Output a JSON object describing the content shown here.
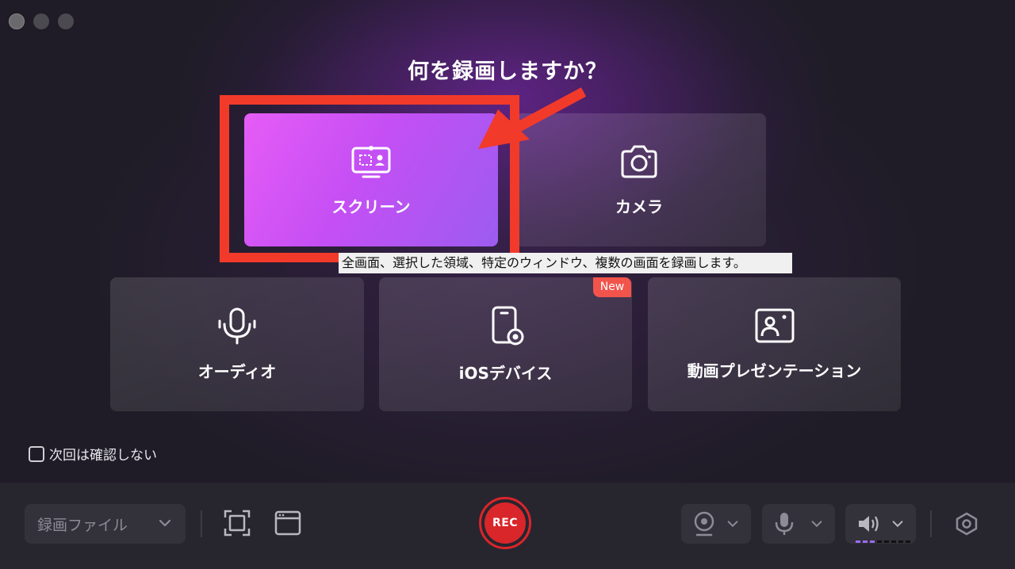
{
  "window": {
    "title": "何を録画しますか？"
  },
  "cards": [
    {
      "id": "screen",
      "label": "スクリーン",
      "icon": "screen-record-icon",
      "selected": true
    },
    {
      "id": "camera",
      "label": "カメラ",
      "icon": "camera-icon",
      "selected": false
    },
    {
      "id": "audio",
      "label": "オーディオ",
      "icon": "microphone-icon",
      "selected": false
    },
    {
      "id": "ios",
      "label": "iOSデバイス",
      "icon": "ios-device-icon",
      "selected": false,
      "badge": "New"
    },
    {
      "id": "presentation",
      "label": "動画プレゼンテーション",
      "icon": "presentation-icon",
      "selected": false
    }
  ],
  "tooltip": "全画面、選択した領域、特定のウィンドウ、複数の画面を録画します。",
  "options": {
    "dont_ask_label": "次回は確認しない",
    "dont_ask_checked": false
  },
  "toolbar": {
    "file_dropdown_value": "録画ファイル",
    "rec_label": "REC",
    "audio_level_active_segments": 3,
    "audio_level_total_segments": 8
  },
  "colors": {
    "accent": "#d9262a",
    "selected_card_start": "#e65cf6",
    "selected_card_end": "#9c5cf0",
    "highlight_annotation": "#f23a2a",
    "badge": "#f2544c"
  }
}
